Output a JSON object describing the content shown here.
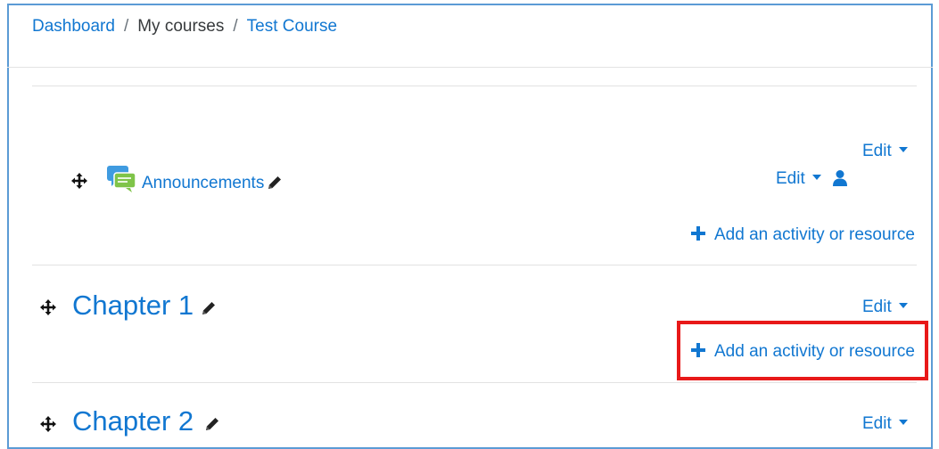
{
  "breadcrumb": {
    "items": [
      {
        "label": "Dashboard",
        "link": true
      },
      {
        "label": "My courses",
        "link": false
      },
      {
        "label": "Test Course",
        "link": true
      }
    ],
    "separator": "/"
  },
  "section_general": {
    "edit_label": "Edit",
    "activity": {
      "name": "Announcements",
      "icon": "forum-icon",
      "edit_label": "Edit",
      "role_icon": "user-icon"
    },
    "add_label": "Add an activity or resource"
  },
  "chapters": [
    {
      "title": "Chapter 1",
      "edit_label": "Edit",
      "add_label": "Add an activity or resource",
      "highlighted": true
    },
    {
      "title": "Chapter 2",
      "edit_label": "Edit"
    }
  ],
  "colors": {
    "link": "#1177d1",
    "highlight": "#e81919",
    "frame": "#5b9bd5"
  }
}
